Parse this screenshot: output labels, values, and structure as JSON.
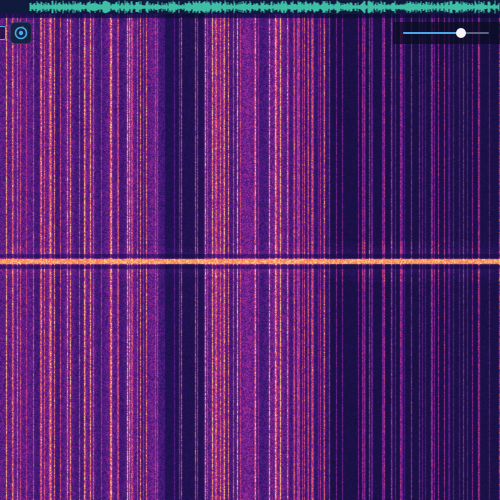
{
  "spectrogram": {
    "palette": "magma",
    "background_color": "#0b0d2a",
    "hot_color": "#ffb347",
    "divider_color": "#ff9a3c"
  },
  "waveform": {
    "color": "#3fbfa6",
    "background_color": "#101a3c"
  },
  "controls": {
    "view_toggle_icon": "panel-toggle-icon",
    "loop_icon": "loop-icon",
    "accent_color": "#4aa8e8"
  },
  "volume": {
    "value_fraction": 0.67
  }
}
